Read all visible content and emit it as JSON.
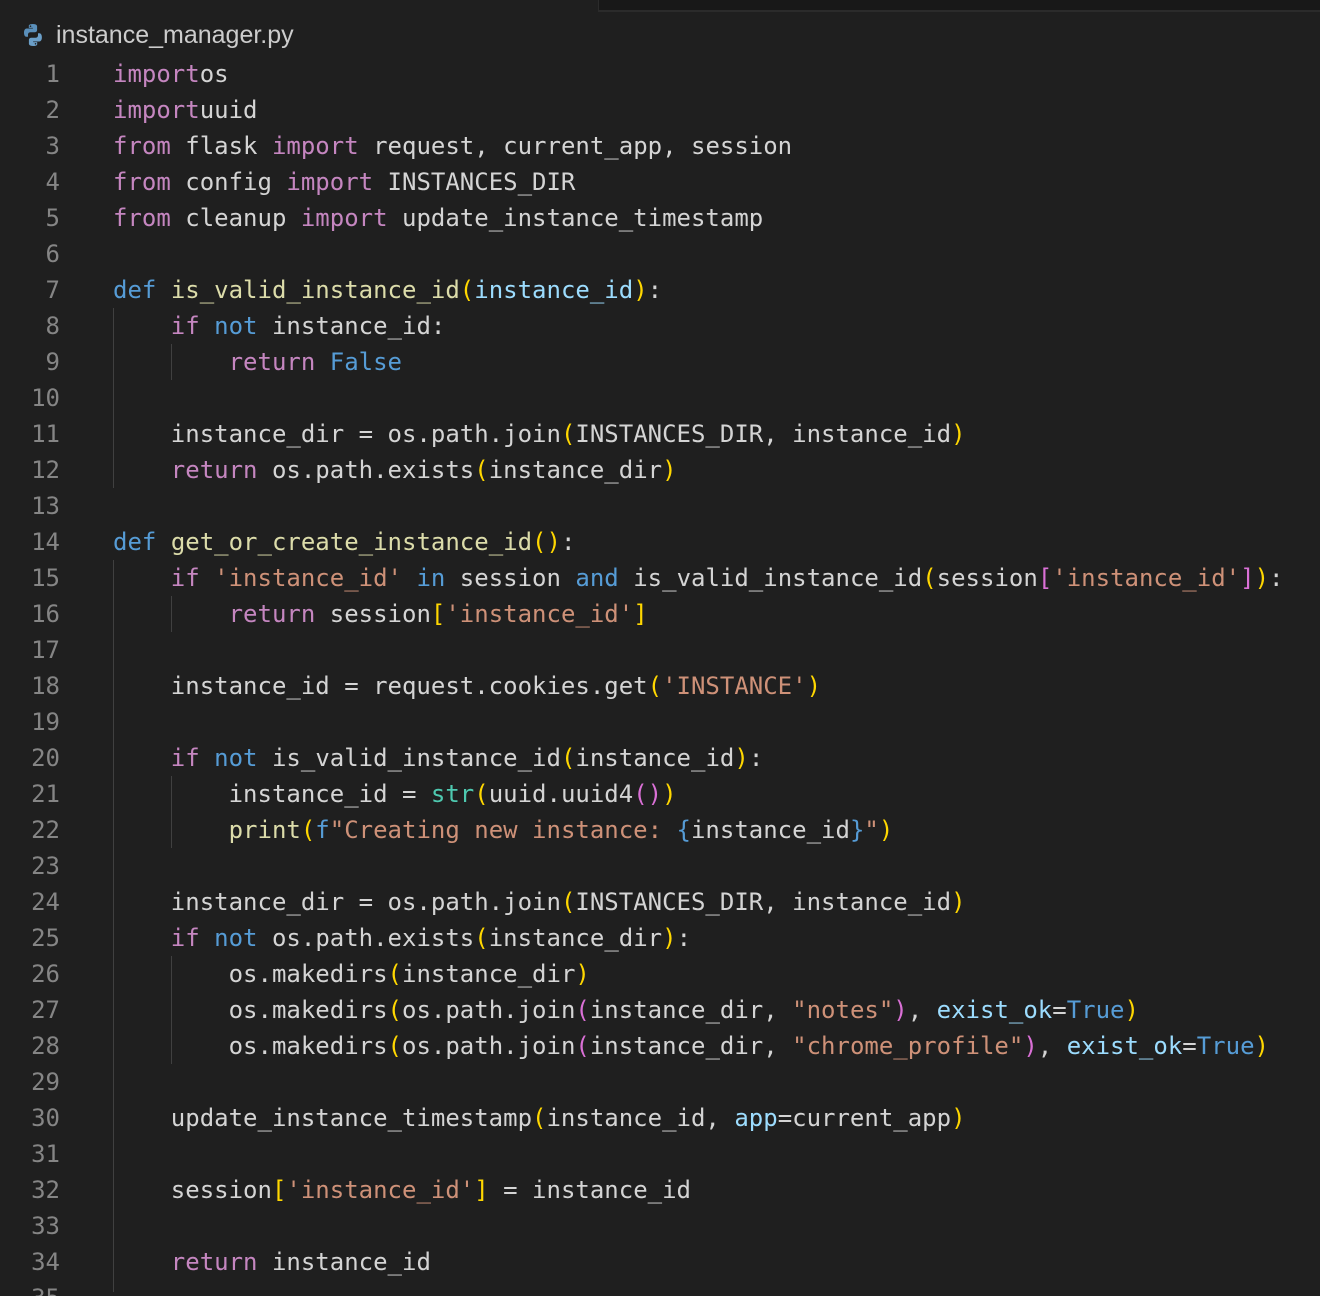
{
  "tab": {
    "file_name": "instance_manager.py",
    "icon": "python-icon"
  },
  "colors": {
    "background": "#1f1f1f",
    "keyword": "#c586c0",
    "storage": "#569cd6",
    "function": "#dcdcaa",
    "parameter": "#9cdcfe",
    "string": "#ce9178",
    "builtin": "#4ec9b0",
    "line_number": "#858585"
  },
  "editor": {
    "lines": [
      [
        [
          "k",
          "import"
        ],
        [
          "",
          "os"
        ]
      ],
      [
        [
          "k",
          "import"
        ],
        [
          "",
          "uuid"
        ]
      ],
      [
        [
          "k",
          "from"
        ],
        [
          "",
          " flask "
        ],
        [
          "k",
          "import"
        ],
        [
          "",
          " request, current_app, session"
        ]
      ],
      [
        [
          "k",
          "from"
        ],
        [
          "",
          " config "
        ],
        [
          "k",
          "import"
        ],
        [
          "",
          " INSTANCES_DIR"
        ]
      ],
      [
        [
          "k",
          "from"
        ],
        [
          "",
          " cleanup "
        ],
        [
          "k",
          "import"
        ],
        [
          "",
          " update_instance_timestamp"
        ]
      ],
      [],
      [
        [
          "s",
          "def"
        ],
        [
          "",
          " "
        ],
        [
          "fn",
          "is_valid_instance_id"
        ],
        [
          "b1",
          "("
        ],
        [
          "pa",
          "instance_id"
        ],
        [
          "b1",
          ")"
        ],
        [
          "",
          ":"
        ]
      ],
      [
        [
          "",
          "    "
        ],
        [
          "k",
          "if"
        ],
        [
          "",
          " "
        ],
        [
          "s",
          "not"
        ],
        [
          "",
          " instance_id:"
        ]
      ],
      [
        [
          "",
          "        "
        ],
        [
          "k",
          "return"
        ],
        [
          "",
          " "
        ],
        [
          "s",
          "False"
        ]
      ],
      [],
      [
        [
          "",
          "    instance_dir = os.path.join"
        ],
        [
          "b1",
          "("
        ],
        [
          "",
          "INSTANCES_DIR, instance_id"
        ],
        [
          "b1",
          ")"
        ]
      ],
      [
        [
          "",
          "    "
        ],
        [
          "k",
          "return"
        ],
        [
          "",
          " os.path.exists"
        ],
        [
          "b1",
          "("
        ],
        [
          "",
          "instance_dir"
        ],
        [
          "b1",
          ")"
        ]
      ],
      [],
      [
        [
          "s",
          "def"
        ],
        [
          "",
          " "
        ],
        [
          "fn",
          "get_or_create_instance_id"
        ],
        [
          "b1",
          "()"
        ],
        [
          "",
          ":"
        ]
      ],
      [
        [
          "",
          "    "
        ],
        [
          "k",
          "if"
        ],
        [
          "",
          " "
        ],
        [
          "st",
          "'instance_id'"
        ],
        [
          "",
          " "
        ],
        [
          "s",
          "in"
        ],
        [
          "",
          " session "
        ],
        [
          "s",
          "and"
        ],
        [
          "",
          " is_valid_instance_id"
        ],
        [
          "b1",
          "("
        ],
        [
          "",
          "session"
        ],
        [
          "b2",
          "["
        ],
        [
          "st",
          "'instance_id'"
        ],
        [
          "b2",
          "]"
        ],
        [
          "b1",
          ")"
        ],
        [
          "",
          ":"
        ]
      ],
      [
        [
          "",
          "        "
        ],
        [
          "k",
          "return"
        ],
        [
          "",
          " session"
        ],
        [
          "b1",
          "["
        ],
        [
          "st",
          "'instance_id'"
        ],
        [
          "b1",
          "]"
        ]
      ],
      [],
      [
        [
          "",
          "    instance_id = request.cookies.get"
        ],
        [
          "b1",
          "("
        ],
        [
          "st",
          "'INSTANCE'"
        ],
        [
          "b1",
          ")"
        ]
      ],
      [],
      [
        [
          "",
          "    "
        ],
        [
          "k",
          "if"
        ],
        [
          "",
          " "
        ],
        [
          "s",
          "not"
        ],
        [
          "",
          " is_valid_instance_id"
        ],
        [
          "b1",
          "("
        ],
        [
          "",
          "instance_id"
        ],
        [
          "b1",
          ")"
        ],
        [
          "",
          ":"
        ]
      ],
      [
        [
          "",
          "        instance_id = "
        ],
        [
          "bi",
          "str"
        ],
        [
          "b1",
          "("
        ],
        [
          "",
          "uuid.uuid4"
        ],
        [
          "b2",
          "()"
        ],
        [
          "b1",
          ")"
        ]
      ],
      [
        [
          "",
          "        "
        ],
        [
          "fn",
          "print"
        ],
        [
          "b1",
          "("
        ],
        [
          "s",
          "f"
        ],
        [
          "st",
          "\"Creating new instance: "
        ],
        [
          "s",
          "{"
        ],
        [
          "",
          "instance_id"
        ],
        [
          "s",
          "}"
        ],
        [
          "st",
          "\""
        ],
        [
          "b1",
          ")"
        ]
      ],
      [],
      [
        [
          "",
          "    instance_dir = os.path.join"
        ],
        [
          "b1",
          "("
        ],
        [
          "",
          "INSTANCES_DIR, instance_id"
        ],
        [
          "b1",
          ")"
        ]
      ],
      [
        [
          "",
          "    "
        ],
        [
          "k",
          "if"
        ],
        [
          "",
          " "
        ],
        [
          "s",
          "not"
        ],
        [
          "",
          " os.path.exists"
        ],
        [
          "b1",
          "("
        ],
        [
          "",
          "instance_dir"
        ],
        [
          "b1",
          ")"
        ],
        [
          "",
          ":"
        ]
      ],
      [
        [
          "",
          "        os.makedirs"
        ],
        [
          "b1",
          "("
        ],
        [
          "",
          "instance_dir"
        ],
        [
          "b1",
          ")"
        ]
      ],
      [
        [
          "",
          "        os.makedirs"
        ],
        [
          "b1",
          "("
        ],
        [
          "",
          "os.path.join"
        ],
        [
          "b2",
          "("
        ],
        [
          "",
          "instance_dir, "
        ],
        [
          "st",
          "\"notes\""
        ],
        [
          "b2",
          ")"
        ],
        [
          "",
          ", "
        ],
        [
          "pa",
          "exist_ok"
        ],
        [
          "",
          "="
        ],
        [
          "s",
          "True"
        ],
        [
          "b1",
          ")"
        ]
      ],
      [
        [
          "",
          "        os.makedirs"
        ],
        [
          "b1",
          "("
        ],
        [
          "",
          "os.path.join"
        ],
        [
          "b2",
          "("
        ],
        [
          "",
          "instance_dir, "
        ],
        [
          "st",
          "\"chrome_profile\""
        ],
        [
          "b2",
          ")"
        ],
        [
          "",
          ", "
        ],
        [
          "pa",
          "exist_ok"
        ],
        [
          "",
          "="
        ],
        [
          "s",
          "True"
        ],
        [
          "b1",
          ")"
        ]
      ],
      [],
      [
        [
          "",
          "    update_instance_timestamp"
        ],
        [
          "b1",
          "("
        ],
        [
          "",
          "instance_id, "
        ],
        [
          "pa",
          "app"
        ],
        [
          "",
          "=current_app"
        ],
        [
          "b1",
          ")"
        ]
      ],
      [],
      [
        [
          "",
          "    session"
        ],
        [
          "b1",
          "["
        ],
        [
          "st",
          "'instance_id'"
        ],
        [
          "b1",
          "]"
        ],
        [
          "",
          " = instance_id"
        ]
      ],
      [],
      [
        [
          "",
          "    "
        ],
        [
          "k",
          "return"
        ],
        [
          "",
          " instance_id"
        ]
      ],
      []
    ]
  }
}
